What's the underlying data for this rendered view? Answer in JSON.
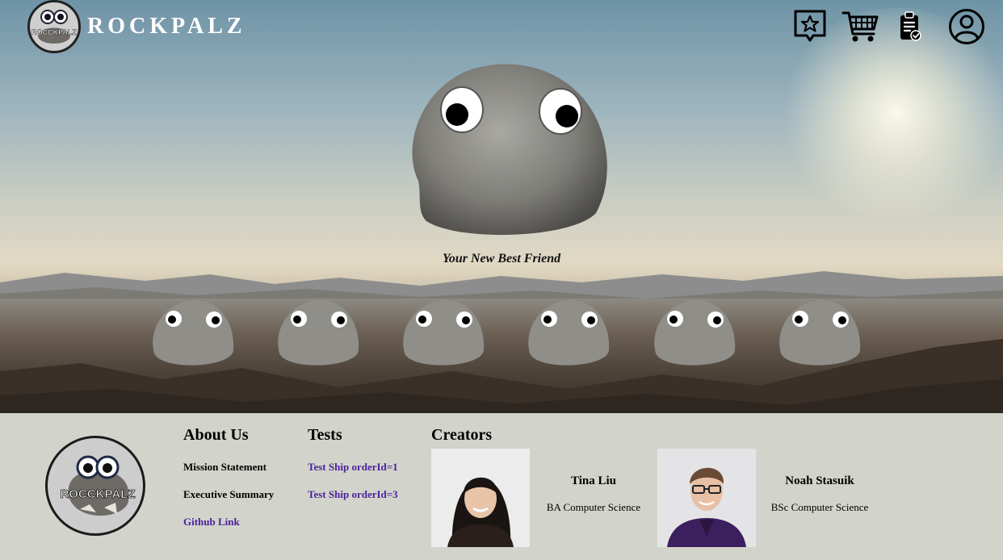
{
  "header": {
    "brand_name": "ROCKPALZ",
    "logo_text": "ROCCKPALZ",
    "icons": [
      "wishlist-star-icon",
      "cart-icon",
      "orders-clipboard-icon",
      "account-user-icon"
    ]
  },
  "hero": {
    "tagline": "Your New Best Friend"
  },
  "footer": {
    "logo_text": "ROCCKPALZ",
    "about": {
      "title": "About Us",
      "items": [
        "Mission Statement",
        "Executive Summary"
      ],
      "link": "Github Link"
    },
    "tests": {
      "title": "Tests",
      "links": [
        "Test Ship orderId=1",
        "Test Ship orderId=3"
      ]
    },
    "creators": {
      "title": "Creators",
      "people": [
        {
          "name": "Tina Liu",
          "degree": "BA Computer Science"
        },
        {
          "name": "Noah Stasuik",
          "degree": "BSc Computer Science"
        }
      ]
    }
  },
  "colors": {
    "link": "#4b1fa0",
    "footer_bg": "#d2d4cb"
  }
}
